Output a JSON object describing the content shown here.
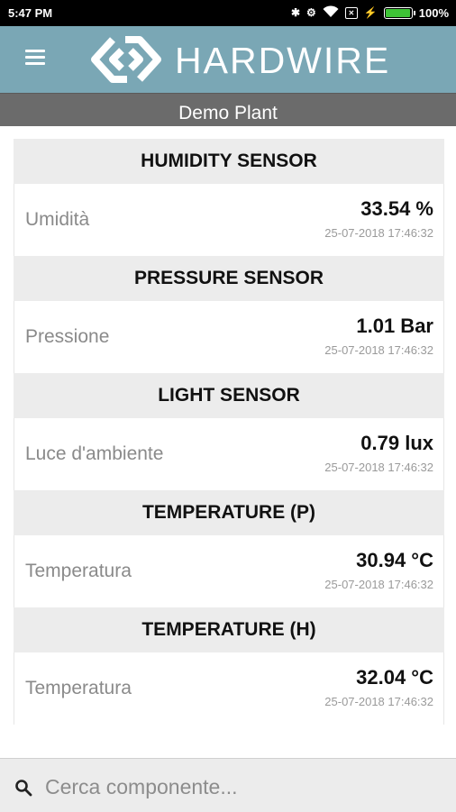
{
  "status_bar": {
    "time": "5:47 PM",
    "battery_percent": "100%",
    "battery_level": 1.0,
    "icons": [
      "bluetooth-icon",
      "alarm-icon",
      "wifi-icon",
      "sim-icon",
      "charging-icon",
      "battery-icon"
    ]
  },
  "app_bar": {
    "brand": "HARDWIRE",
    "logo_icon": "hardwire-logo",
    "menu_icon": "hamburger-menu-icon",
    "accent_color": "#7aa7b5"
  },
  "plant": {
    "name": "Demo Plant"
  },
  "sensors": [
    {
      "title": "HUMIDITY SENSOR",
      "label": "Umidità",
      "value": "33.54 %",
      "timestamp": "25-07-2018 17:46:32"
    },
    {
      "title": "PRESSURE SENSOR",
      "label": "Pressione",
      "value": "1.01 Bar",
      "timestamp": "25-07-2018 17:46:32"
    },
    {
      "title": "LIGHT SENSOR",
      "label": "Luce d'ambiente",
      "value": "0.79 lux",
      "timestamp": "25-07-2018 17:46:32"
    },
    {
      "title": "TEMPERATURE (P)",
      "label": "Temperatura",
      "value": "30.94 °C",
      "timestamp": "25-07-2018 17:46:32"
    },
    {
      "title": "TEMPERATURE (H)",
      "label": "Temperatura",
      "value": "32.04 °C",
      "timestamp": "25-07-2018 17:46:32"
    }
  ],
  "search": {
    "placeholder": "Cerca componente..."
  }
}
